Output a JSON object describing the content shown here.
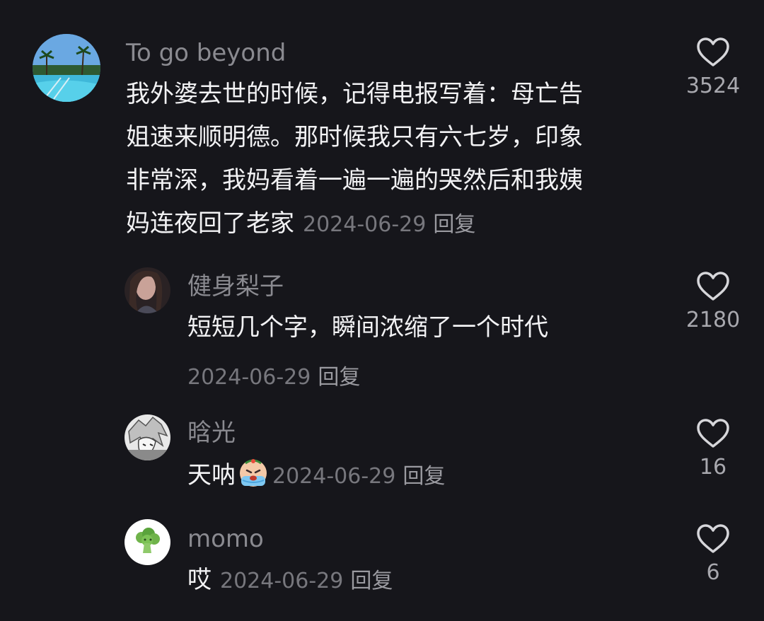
{
  "comments": [
    {
      "username": "To go beyond",
      "text_lines": [
        "我外婆去世的时候，记得电报写着：母亡告",
        "姐速来顺明德。那时候我只有六七岁，印象",
        "非常深，我妈看着一遍一遍的哭然后和我姨",
        "妈连夜回了老家"
      ],
      "date": "2024-06-29",
      "reply_label": "回复",
      "likes": "3524",
      "avatar_icon": "pool-palm-tree-avatar-icon"
    },
    {
      "username": "健身梨子",
      "text": "短短几个字，瞬间浓缩了一个时代",
      "date": "2024-06-29",
      "reply_label": "回复",
      "likes": "2180",
      "avatar_icon": "portrait-avatar-icon"
    },
    {
      "username": "晗光",
      "text": "天呐",
      "emoji": "crying-emoji-icon",
      "date": "2024-06-29",
      "reply_label": "回复",
      "likes": "16",
      "avatar_icon": "manga-avatar-icon"
    },
    {
      "username": "momo",
      "text": "哎",
      "date": "2024-06-29",
      "reply_label": "回复",
      "likes": "6",
      "avatar_icon": "broccoli-avatar-icon"
    }
  ],
  "colors": {
    "background": "#16161b",
    "text": "#f2f2f4",
    "username": "#8a8a90",
    "meta": "#77777d"
  }
}
